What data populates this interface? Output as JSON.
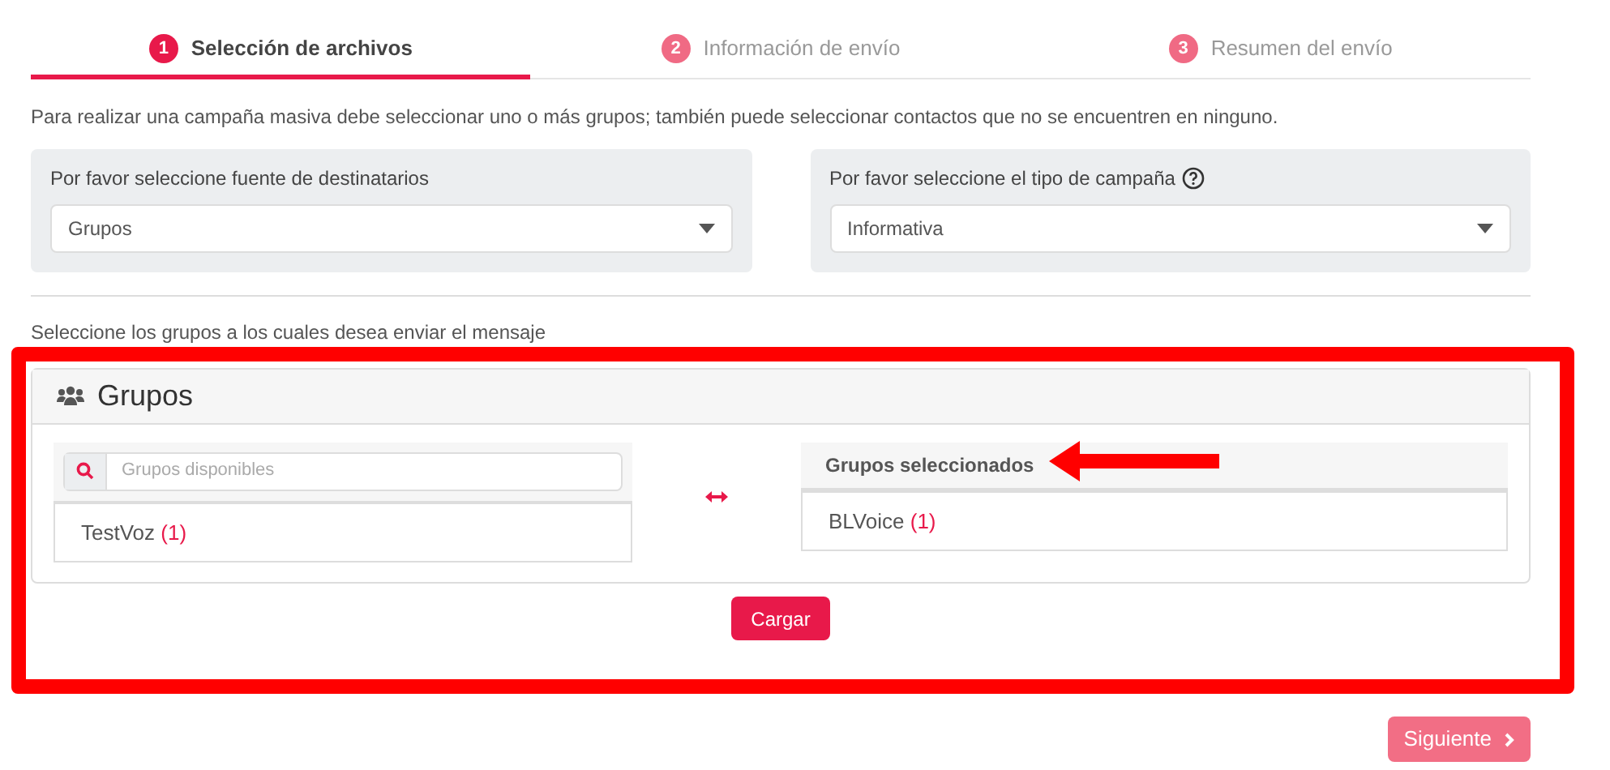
{
  "steps": [
    {
      "number": "1",
      "label": "Selección de archivos",
      "selected": true
    },
    {
      "number": "2",
      "label": "Información de envío",
      "selected": false
    },
    {
      "number": "3",
      "label": "Resumen del envío",
      "selected": false
    }
  ],
  "intro": "Para realizar una campaña masiva debe seleccionar uno o más grupos; también puede seleccionar contactos que no se encuentren en ninguno.",
  "selects": [
    {
      "label": "Por favor seleccione fuente de destinatarios",
      "value": "Grupos",
      "help": false
    },
    {
      "label": "Por favor seleccione el tipo de campaña",
      "value": "Informativa",
      "help": true
    }
  ],
  "groups_prompt": "Seleccione los grupos a los cuales desea enviar el mensaje",
  "groups_card": {
    "title": "Grupos",
    "available": {
      "placeholder": "Grupos disponibles",
      "items": [
        {
          "name": "TestVoz",
          "count": "(1)"
        }
      ]
    },
    "selected_list": {
      "title": "Grupos seleccionados",
      "items": [
        {
          "name": "BLVoice",
          "count": "(1)"
        }
      ]
    },
    "load_button": "Cargar"
  },
  "next_button": {
    "label": "Siguiente",
    "disabled": true
  }
}
